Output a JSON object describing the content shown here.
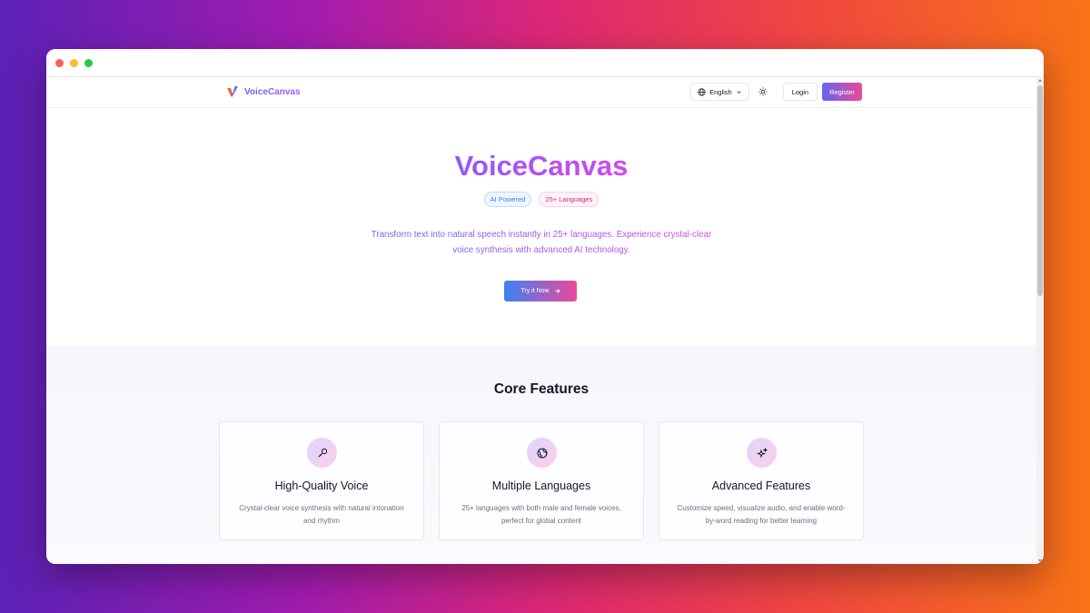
{
  "navbar": {
    "brand": "VoiceCanvas",
    "language": "English",
    "login_label": "Login",
    "register_label": "Register"
  },
  "hero": {
    "title": "VoiceCanvas",
    "badges": [
      "AI Powered",
      "25+ Languages"
    ],
    "description": "Transform text into natural speech instantly in 25+ languages. Experience crystal-clear voice synthesis with advanced AI technology.",
    "cta_label": "Try it Now"
  },
  "features": {
    "title": "Core Features",
    "items": [
      {
        "icon": "mic-icon",
        "title": "High-Quality Voice",
        "description": "Crystal-clear voice synthesis with natural intonation and rhythm"
      },
      {
        "icon": "globe-icon",
        "title": "Multiple Languages",
        "description": "25+ languages with both male and female voices, perfect for global content"
      },
      {
        "icon": "sparkles-icon",
        "title": "Advanced Features",
        "description": "Customize speed, visualize audio, and enable word-by-word reading for better learning"
      }
    ]
  },
  "colors": {
    "brand_gradient_start": "#6366f1",
    "brand_gradient_end": "#ec4899",
    "title_gradient_start": "#8b5cf6",
    "title_gradient_end": "#d946ef"
  }
}
